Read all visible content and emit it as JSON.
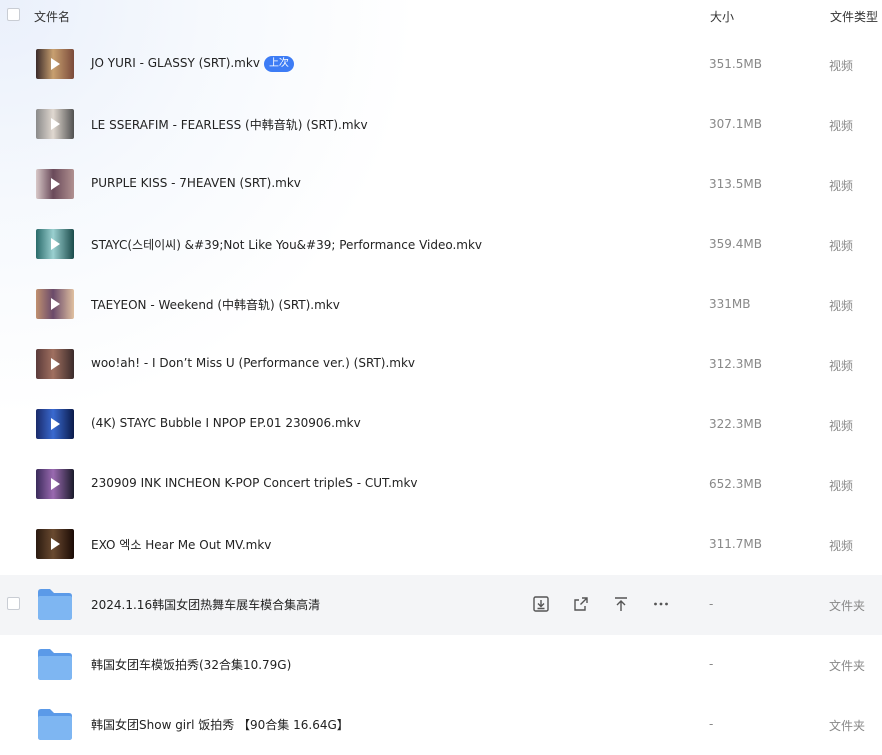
{
  "header": {
    "name_label": "文件名",
    "size_label": "大小",
    "type_label": "文件类型"
  },
  "colors": {
    "accent": "#3d7cf5",
    "folder": "#6aa8f0",
    "hover_row": "#f4f5f7"
  },
  "files": [
    {
      "name": "JO YURI - GLASSY (SRT).mkv",
      "badge": "上次",
      "size": "351.5MB",
      "type": "视频",
      "thumb": [
        "#3a2a2a",
        "#c8a070",
        "#7a4a3a"
      ]
    },
    {
      "name": "LE SSERAFIM - FEARLESS (中韩音轨) (SRT).mkv",
      "badge": "",
      "size": "307.1MB",
      "type": "视频",
      "thumb": [
        "#8a8a8a",
        "#e0d8d0",
        "#505050"
      ]
    },
    {
      "name": "PURPLE KISS - 7HEAVEN (SRT).mkv",
      "badge": "",
      "size": "313.5MB",
      "type": "视频",
      "thumb": [
        "#d8c8c8",
        "#6a4a5a",
        "#b09090"
      ]
    },
    {
      "name": "STAYC(스테이씨) &#39;Not Like You&#39; Performance Video.mkv",
      "badge": "",
      "size": "359.4MB",
      "type": "视频",
      "thumb": [
        "#2a6a6a",
        "#9ad0d0",
        "#1a4a4a"
      ]
    },
    {
      "name": "TAEYEON - Weekend (中韩音轨) (SRT).mkv",
      "badge": "",
      "size": "331MB",
      "type": "视频",
      "thumb": [
        "#c09070",
        "#6a4a6a",
        "#e0c0a0"
      ]
    },
    {
      "name": "woo!ah! - I Don’t Miss U (Performance ver.) (SRT).mkv",
      "badge": "",
      "size": "312.3MB",
      "type": "视频",
      "thumb": [
        "#5a3a3a",
        "#a07060",
        "#3a2a2a"
      ]
    },
    {
      "name": "(4K) STAYC Bubble I NPOP EP.01 230906.mkv",
      "badge": "",
      "size": "322.3MB",
      "type": "视频",
      "thumb": [
        "#1a2a6a",
        "#3a6ad0",
        "#0a1a4a"
      ]
    },
    {
      "name": "230909 INK INCHEON K-POP Concert tripleS - CUT.mkv",
      "badge": "",
      "size": "652.3MB",
      "type": "视频",
      "thumb": [
        "#3a2a5a",
        "#9a6ab0",
        "#1a1a2a"
      ]
    },
    {
      "name": "EXO 엑소 Hear Me Out MV.mkv",
      "badge": "",
      "size": "311.7MB",
      "type": "视频",
      "thumb": [
        "#2a1a10",
        "#6a4a30",
        "#1a0a05"
      ]
    }
  ],
  "folders": [
    {
      "name": "2024.1.16韩国女团热舞车展车模合集高清",
      "size": "-",
      "type": "文件夹",
      "hover": true
    },
    {
      "name": "韩国女团车模饭拍秀(32合集10.79G)",
      "size": "-",
      "type": "文件夹",
      "hover": false
    },
    {
      "name": "韩国女团Show girl 饭拍秀 【90合集 16.64G】",
      "size": "-",
      "type": "文件夹",
      "hover": false
    }
  ],
  "actions": [
    {
      "icon": "download-icon"
    },
    {
      "icon": "share-icon"
    },
    {
      "icon": "move-to-top-icon"
    },
    {
      "icon": "more-icon"
    }
  ]
}
